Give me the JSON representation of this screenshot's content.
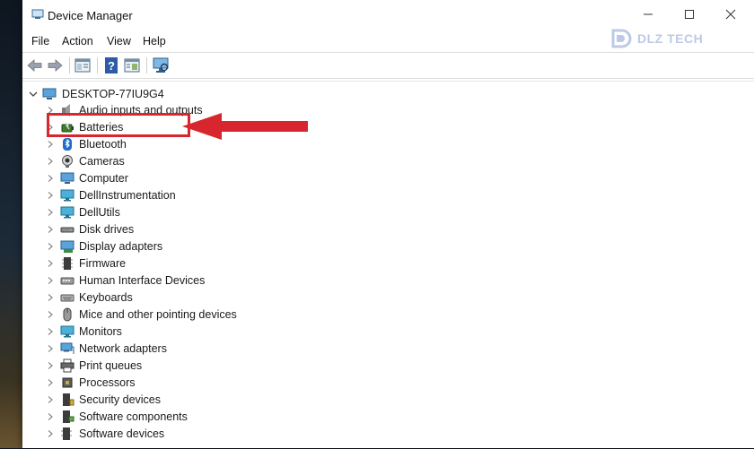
{
  "window": {
    "title": "Device Manager"
  },
  "menu": [
    "File",
    "Action",
    "View",
    "Help"
  ],
  "watermark": "DLZ TECH",
  "toolbar": [
    "back",
    "forward",
    "properties",
    "help",
    "show-hidden",
    "scan"
  ],
  "tree": {
    "root": "DESKTOP-77IU9G4",
    "items": [
      {
        "label": "Audio inputs and outputs",
        "icon": "speaker-icon"
      },
      {
        "label": "Batteries",
        "icon": "battery-icon"
      },
      {
        "label": "Bluetooth",
        "icon": "bluetooth-icon"
      },
      {
        "label": "Cameras",
        "icon": "camera-icon"
      },
      {
        "label": "Computer",
        "icon": "computer-icon"
      },
      {
        "label": "DellInstrumentation",
        "icon": "monitor-icon"
      },
      {
        "label": "DellUtils",
        "icon": "monitor-icon"
      },
      {
        "label": "Disk drives",
        "icon": "disk-drive-icon"
      },
      {
        "label": "Display adapters",
        "icon": "display-adapter-icon"
      },
      {
        "label": "Firmware",
        "icon": "firmware-icon"
      },
      {
        "label": "Human Interface Devices",
        "icon": "hid-icon"
      },
      {
        "label": "Keyboards",
        "icon": "keyboard-icon"
      },
      {
        "label": "Mice and other pointing devices",
        "icon": "mouse-icon"
      },
      {
        "label": "Monitors",
        "icon": "monitor-icon"
      },
      {
        "label": "Network adapters",
        "icon": "network-icon"
      },
      {
        "label": "Print queues",
        "icon": "printer-icon"
      },
      {
        "label": "Processors",
        "icon": "processor-icon"
      },
      {
        "label": "Security devices",
        "icon": "security-chip-icon"
      },
      {
        "label": "Software components",
        "icon": "software-component-icon"
      },
      {
        "label": "Software devices",
        "icon": "software-device-icon"
      }
    ]
  },
  "annotation": {
    "highlighted_item": "Batteries",
    "color": "#d8262e"
  }
}
